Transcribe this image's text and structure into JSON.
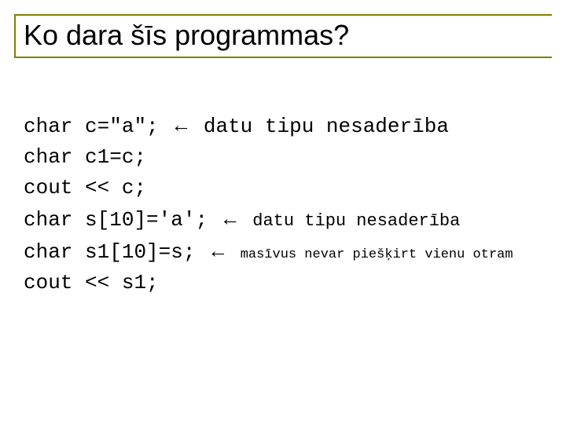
{
  "title": "Ko dara šīs programmas?",
  "arrow": "←",
  "lines": {
    "l1_kw": "char",
    "l1_code": "c=\"a\";",
    "l1_note": "datu tipu nesaderība",
    "l2_kw": "char",
    "l2_code": "c1=c;",
    "l3_kw": "cout",
    "l3_code": "<< c;",
    "l4_kw": "char",
    "l4_code": "s[10]='a';",
    "l4_note": "datu tipu nesaderība",
    "l5_kw": "char",
    "l5_code": "s1[10]=s;",
    "l5_note": "masīvus nevar piešķirt vienu otram",
    "l6_kw": "cout",
    "l6_code": "<< s1;"
  }
}
